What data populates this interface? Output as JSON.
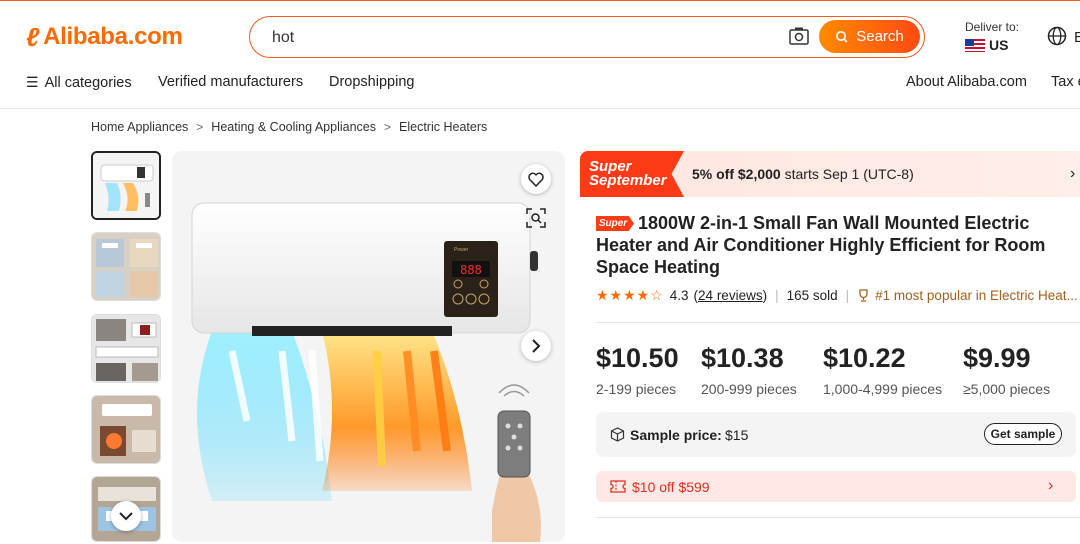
{
  "header": {
    "logo_text": "Alibaba.com",
    "search_value": "hot",
    "search_button": "Search",
    "deliver_label": "Deliver to:",
    "deliver_country": "US",
    "language_partial": "E"
  },
  "nav": {
    "all_categories": "All categories",
    "verified": "Verified manufacturers",
    "dropshipping": "Dropshipping",
    "about": "About Alibaba.com",
    "tax_partial": "Tax e"
  },
  "breadcrumb": [
    "Home Appliances",
    "Heating & Cooling Appliances",
    "Electric Heaters"
  ],
  "display": {
    "heater_digits": "888",
    "heater_panel_label": "Power"
  },
  "promo": {
    "badge_line1": "Super",
    "badge_line2": "September",
    "text_bold": "5% off $2,000",
    "text_rest": " starts Sep 1 (UTC-8)"
  },
  "product": {
    "super_tag": "Super",
    "title": "1800W 2-in-1 Small Fan Wall Mounted Electric Heater and Air Conditioner Highly Efficient for Room Space Heating",
    "rating": "4.3",
    "rating_value": 4.3,
    "reviews": "24 reviews",
    "sold": "165 sold",
    "popular": "#1 most popular in Electric Heat..."
  },
  "prices": [
    {
      "price": "$10.50",
      "qty": "2-199 pieces"
    },
    {
      "price": "$10.38",
      "qty": "200-999 pieces"
    },
    {
      "price": "$10.22",
      "qty": "1,000-4,999 pieces"
    },
    {
      "price": "$9.99",
      "qty": "≥5,000 pieces"
    }
  ],
  "sample": {
    "label": "Sample price:",
    "value": "$15",
    "button": "Get sample"
  },
  "coupon": {
    "text": "$10 off $599"
  },
  "colors": {
    "brand": "#ff6a00",
    "promo_red": "#ff3a17",
    "coupon_red": "#e0301e",
    "popular": "#a4611e"
  }
}
